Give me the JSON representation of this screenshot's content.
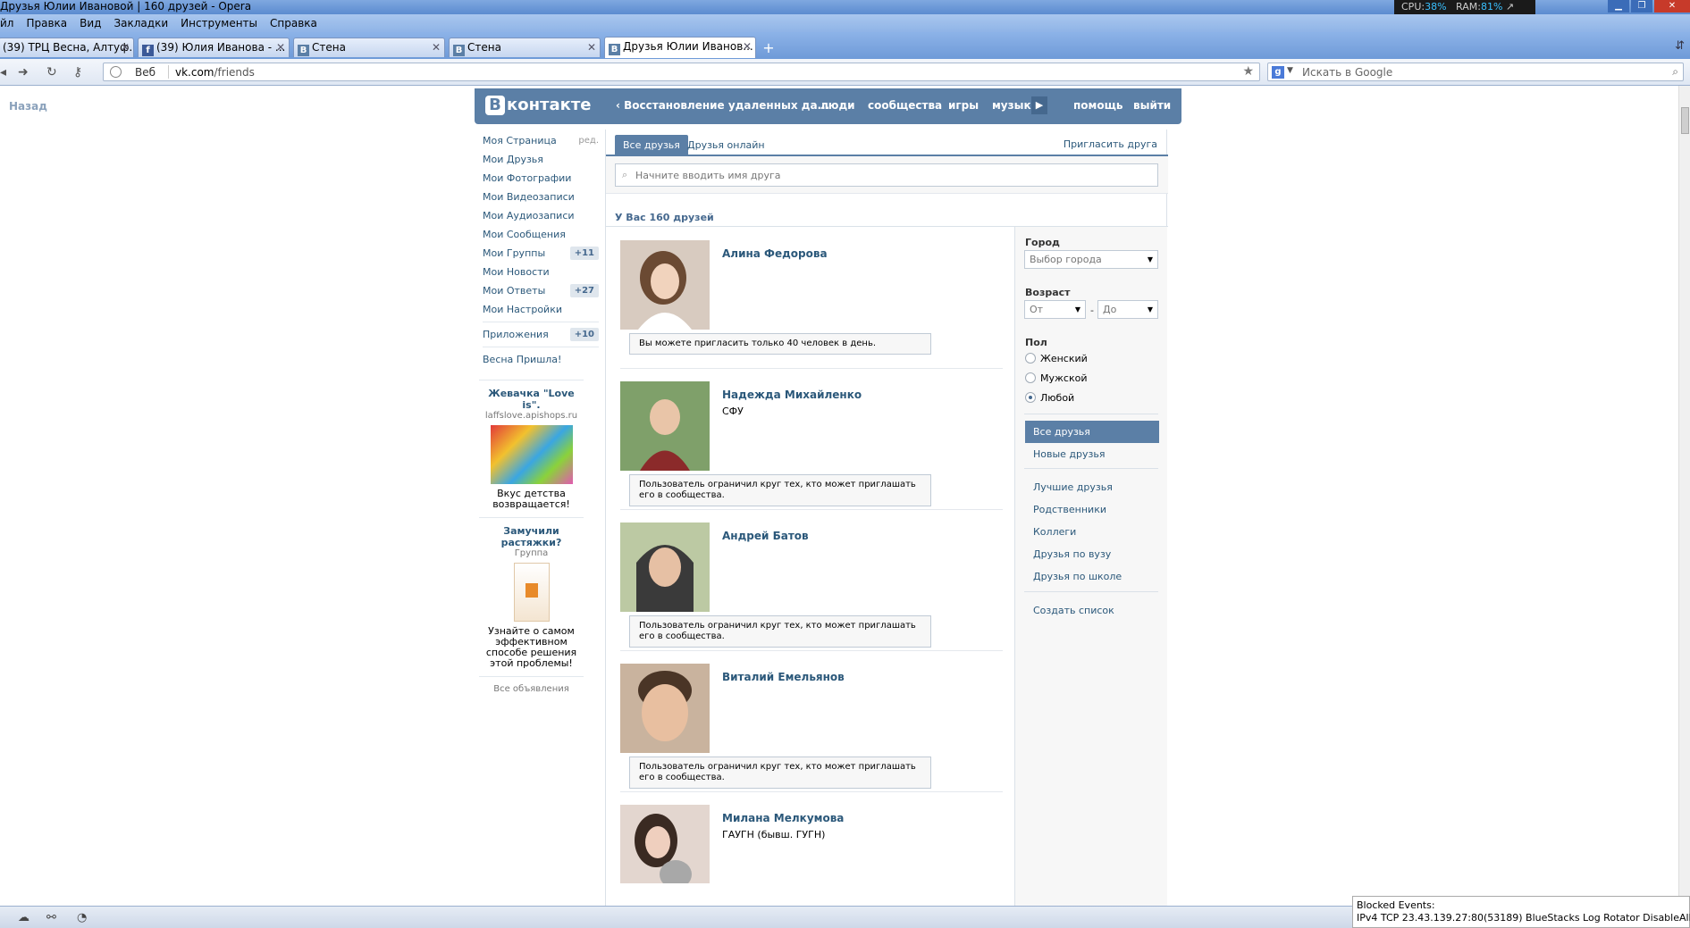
{
  "browser": {
    "window_title": "Друзья Юлии Ивановой | 160 друзей - Opera",
    "sysmon": {
      "cpu_label": "CPU:",
      "cpu": "38%",
      "ram_label": "RAM:",
      "ram": "81%"
    },
    "menu": [
      "йл",
      "Правка",
      "Вид",
      "Закладки",
      "Инструменты",
      "Справка"
    ],
    "tabs": [
      {
        "label": "(39) ТРЦ Весна, Алтуф...",
        "icon": "none"
      },
      {
        "label": "(39) Юлия Иванова - ...",
        "icon": "facebook-icon"
      },
      {
        "label": "Стена",
        "icon": "vk-icon"
      },
      {
        "label": "Стена",
        "icon": "vk-icon"
      },
      {
        "label": "Друзья Юлии Иванов...",
        "icon": "vk-icon"
      }
    ],
    "address": {
      "web_label": "Веб",
      "host": "vk.com",
      "path": "/friends"
    },
    "search_placeholder": "Искать в Google",
    "back_label": "Назад",
    "blocked_title": "Blocked Events:",
    "blocked_text": "IPv4 TCP 23.43.139.27:80(53189) BlueStacks Log Rotator DisableAll Outgoing"
  },
  "vk": {
    "logo": "контакте",
    "logo_letter": "В",
    "nav": {
      "current": "Восстановление удаленных да...",
      "people": "люди",
      "communities": "сообщества",
      "games": "игры",
      "music": "музыка",
      "help": "помощь",
      "logout": "выйти"
    },
    "left_menu": [
      {
        "label": "Моя Страница",
        "extra": "ред."
      },
      {
        "label": "Мои Друзья"
      },
      {
        "label": "Мои Фотографии"
      },
      {
        "label": "Мои Видеозаписи"
      },
      {
        "label": "Мои Аудиозаписи"
      },
      {
        "label": "Мои Сообщения"
      },
      {
        "label": "Мои Группы",
        "badge": "+11"
      },
      {
        "label": "Мои Новости"
      },
      {
        "label": "Мои Ответы",
        "badge": "+27"
      },
      {
        "label": "Мои Настройки"
      }
    ],
    "apps": {
      "label": "Приложения",
      "badge": "+10"
    },
    "spring": "Весна Пришла!",
    "ads": [
      {
        "title": "Жевачка \"Love is\".",
        "sub": "laffslove.apishops.ru",
        "text": "Вкус детства возвращается!"
      },
      {
        "title": "Замучили растяжки?",
        "sub": "Группа",
        "text": "Узнайте о самом эффективном способе решения этой проблемы!"
      }
    ],
    "all_ads": "Все объявления",
    "content_tabs": {
      "all": "Все друзья",
      "online": "Друзья онлайн",
      "invite": "Пригласить друга"
    },
    "search_placeholder": "Начните вводить имя друга",
    "count": "У Вас 160 друзей",
    "friends": [
      {
        "name": "Алина Федорова",
        "info": "",
        "note": "Вы можете пригласить только 40 человек в день."
      },
      {
        "name": "Надежда Михайленко",
        "info": "СФУ",
        "note": "Пользователь ограничил круг тех, кто может приглашать его в сообщества."
      },
      {
        "name": "Андрей Батов",
        "info": "",
        "note": "Пользователь ограничил круг тех, кто может приглашать его в сообщества."
      },
      {
        "name": "Виталий Емельянов",
        "info": "",
        "note": "Пользователь ограничил круг тех, кто может приглашать его в сообщества."
      },
      {
        "name": "Милана Мелкумова",
        "info": "ГАУГН (бывш. ГУГН)",
        "note": ""
      }
    ],
    "filters": {
      "city_label": "Город",
      "city_value": "Выбор города",
      "age_label": "Возраст",
      "age_from": "От",
      "age_dash": "-",
      "age_to": "До",
      "sex_label": "Пол",
      "sex_options": [
        "Женский",
        "Мужской",
        "Любой"
      ],
      "sex_selected": "Любой",
      "lists": [
        "Все друзья",
        "Новые друзья"
      ],
      "lists2": [
        "Лучшие друзья",
        "Родственники",
        "Коллеги",
        "Друзья по вузу",
        "Друзья по школе"
      ],
      "create": "Создать список"
    }
  }
}
